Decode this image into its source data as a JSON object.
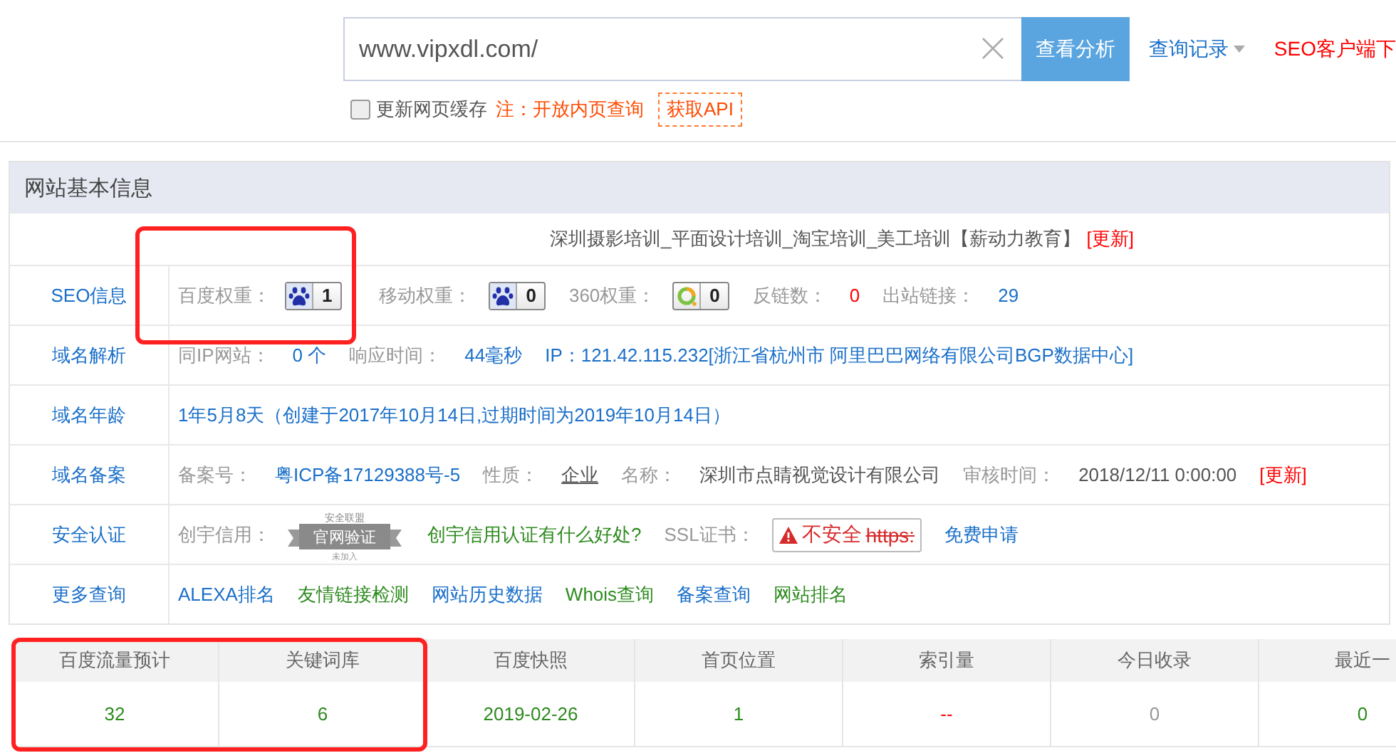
{
  "search": {
    "value": "www.vipxdl.com/",
    "button": "查看分析",
    "history": "查询记录",
    "client_link": "SEO客户端下"
  },
  "options": {
    "refresh_cache": {
      "label": "更新网页缓存",
      "checked": false
    },
    "note": "注：开放内页查询",
    "api_button": "获取API"
  },
  "section_title": "网站基本信息",
  "site_title": {
    "text": "深圳摄影培训_平面设计培训_淘宝培训_美工培训【薪动力教育】",
    "update": "[更新]"
  },
  "rows": [
    {
      "label": "SEO信息",
      "items": [
        {
          "kind": "group",
          "highlighted": true,
          "items": [
            {
              "kind": "label",
              "text": "百度权重："
            },
            {
              "kind": "paw-badge",
              "text": "1"
            }
          ]
        },
        {
          "kind": "label",
          "text": "移动权重："
        },
        {
          "kind": "paw-badge",
          "text": "0"
        },
        {
          "kind": "label",
          "text": "360权重："
        },
        {
          "kind": "ring-badge",
          "text": "0"
        },
        {
          "kind": "label",
          "text": "反链数："
        },
        {
          "kind": "value",
          "text": "0",
          "color": "#ff0000"
        },
        {
          "kind": "label",
          "text": "出站链接："
        },
        {
          "kind": "value",
          "text": "29",
          "color": "#1a6fc9"
        }
      ]
    },
    {
      "label": "域名解析",
      "items": [
        {
          "kind": "label",
          "text": "同IP网站："
        },
        {
          "kind": "value",
          "text": "0 个",
          "color": "#1a6fc9"
        },
        {
          "kind": "label",
          "text": "响应时间："
        },
        {
          "kind": "value",
          "text": "44毫秒",
          "color": "#1a6fc9"
        },
        {
          "kind": "value",
          "text": "IP：121.42.115.232[浙江省杭州市 阿里巴巴网络有限公司BGP数据中心]",
          "color": "#1a6fc9"
        }
      ]
    },
    {
      "label": "域名年龄",
      "items": [
        {
          "kind": "value",
          "text": "1年5月8天（创建于2017年10月14日,过期时间为2019年10月14日）",
          "color": "#1a6fc9"
        }
      ]
    },
    {
      "label": "域名备案",
      "items": [
        {
          "kind": "label",
          "text": "备案号："
        },
        {
          "kind": "link",
          "text": "粤ICP备17129388号-5",
          "color": "#1a6fc9"
        },
        {
          "kind": "label",
          "text": "性质："
        },
        {
          "kind": "link",
          "text": "企业",
          "color": "#555555",
          "underline": true
        },
        {
          "kind": "label",
          "text": "名称："
        },
        {
          "kind": "value",
          "text": "深圳市点睛视觉设计有限公司",
          "color": "#555555"
        },
        {
          "kind": "label",
          "text": "审核时间："
        },
        {
          "kind": "value",
          "text": "2018/12/11 0:00:00",
          "color": "#555555"
        },
        {
          "kind": "link",
          "text": "[更新]",
          "color": "#ff0000"
        }
      ]
    },
    {
      "label": "安全认证",
      "items": [
        {
          "kind": "label",
          "text": "创宇信用："
        },
        {
          "kind": "seal",
          "top": "安全联盟",
          "main": "官网验证",
          "bottom": "未加入"
        },
        {
          "kind": "link",
          "text": "创宇信用认证有什么好处?",
          "color": "#2e8b1f"
        },
        {
          "kind": "label",
          "text": "SSL证书："
        },
        {
          "kind": "alert",
          "text": "不安全",
          "struck": "https:"
        },
        {
          "kind": "link",
          "text": "免费申请",
          "color": "#1a6fc9"
        }
      ]
    },
    {
      "label": "更多查询",
      "items": [
        {
          "kind": "link",
          "text": "ALEXA排名",
          "color": "#1a6fc9"
        },
        {
          "kind": "link",
          "text": "友情链接检测",
          "color": "#2e8b1f"
        },
        {
          "kind": "link",
          "text": "网站历史数据",
          "color": "#1a6fc9"
        },
        {
          "kind": "link",
          "text": "Whois查询",
          "color": "#2e8b1f"
        },
        {
          "kind": "link",
          "text": "备案查询",
          "color": "#1a6fc9"
        },
        {
          "kind": "link",
          "text": "网站排名",
          "color": "#2e8b1f"
        }
      ]
    }
  ],
  "stats": {
    "columns": [
      {
        "header": "百度流量预计",
        "value": "32",
        "color": "#2e8b1f",
        "highlighted": true
      },
      {
        "header": "关键词库",
        "value": "6",
        "color": "#2e8b1f",
        "highlighted": true
      },
      {
        "header": "百度快照",
        "value": "2019-02-26",
        "color": "#2e8b1f",
        "highlighted": false
      },
      {
        "header": "首页位置",
        "value": "1",
        "color": "#2e8b1f",
        "highlighted": false
      },
      {
        "header": "索引量",
        "value": "--",
        "color": "#ff0000",
        "highlighted": false
      },
      {
        "header": "今日收录",
        "value": "0",
        "color": "#999999",
        "highlighted": false
      },
      {
        "header": "最近一",
        "value": "0",
        "color": "#2e8b1f",
        "highlighted": false
      }
    ]
  }
}
